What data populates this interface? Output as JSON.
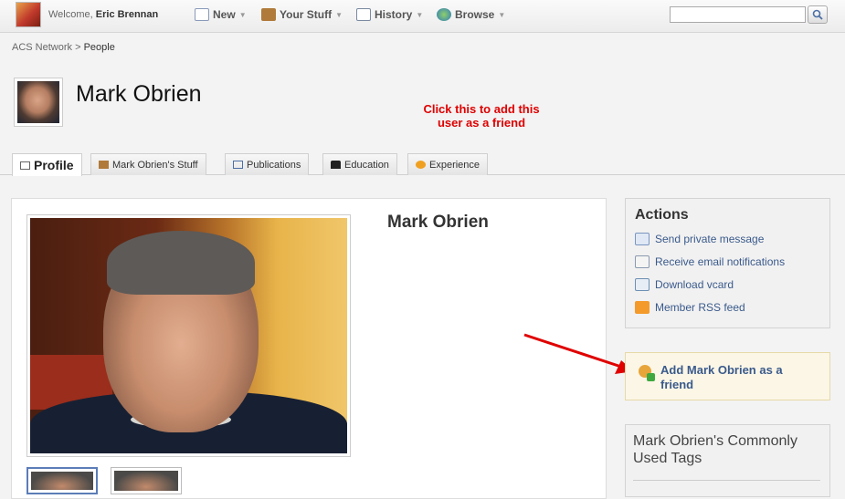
{
  "topbar": {
    "welcome_prefix": "Welcome,",
    "user_name": "Eric Brennan",
    "nav": {
      "new": "New",
      "your_stuff": "Your Stuff",
      "history": "History",
      "browse": "Browse"
    },
    "search_placeholder": ""
  },
  "breadcrumb": {
    "root": "ACS Network",
    "sep": ">",
    "current": "People"
  },
  "page_title": "Mark Obrien",
  "tabs": [
    "Profile",
    "Mark Obrien's Stuff",
    "Publications",
    "Education",
    "Experience"
  ],
  "main": {
    "name": "Mark Obrien"
  },
  "annotation": "Click this to add this user as a friend",
  "actions": {
    "title": "Actions",
    "items": [
      "Send private message",
      "Receive email notifications",
      "Download vcard",
      "Member RSS feed"
    ]
  },
  "add_friend": "Add Mark Obrien as a friend",
  "tags_title": "Mark Obrien's Commonly Used Tags",
  "colors": {
    "accent_link": "#3a5a8c",
    "annotation_red": "#e00000",
    "friend_bg": "#fbf6e6"
  }
}
